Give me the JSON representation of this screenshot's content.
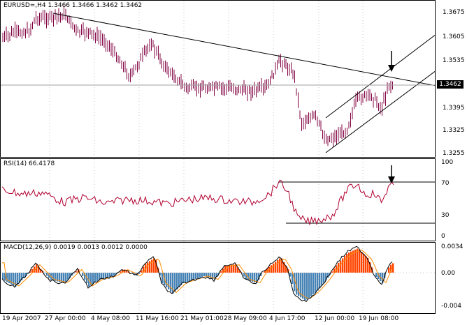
{
  "price_pane": {
    "title": "EURUSD=,H4",
    "ohlc": [
      "1.3466",
      "1.3466",
      "1.3462",
      "1.3462"
    ],
    "y_labels": [
      "1.3675",
      "1.3605",
      "1.3535",
      "1.3465",
      "1.3395",
      "1.3325",
      "1.3255"
    ],
    "current_price": "1.3462"
  },
  "rsi_pane": {
    "title": "RSI(14)",
    "value": "66.4178",
    "y_labels": [
      "100",
      "70",
      "30",
      "0"
    ]
  },
  "macd_pane": {
    "title": "MACD(12,26,9)",
    "values": [
      "0.0019",
      "0.0013",
      "0.0012",
      "0.0000"
    ],
    "y_labels": [
      "0.0034",
      "0.00",
      "-0.004"
    ]
  },
  "time_axis": [
    "19 Apr 2007",
    "27 Apr 00:00",
    "4 May 08:00",
    "11 May 16:00",
    "21 May 01:00",
    "28 May 09:00",
    "4 Jun 17:00",
    "12 Jun 00:00",
    "19 Jun 08:00"
  ],
  "colors": {
    "candle": "#800040",
    "rsi": "#b00030",
    "macd_pos": "#ff4400",
    "macd_neg": "#4682b4",
    "signal": "#ff8c00"
  }
}
